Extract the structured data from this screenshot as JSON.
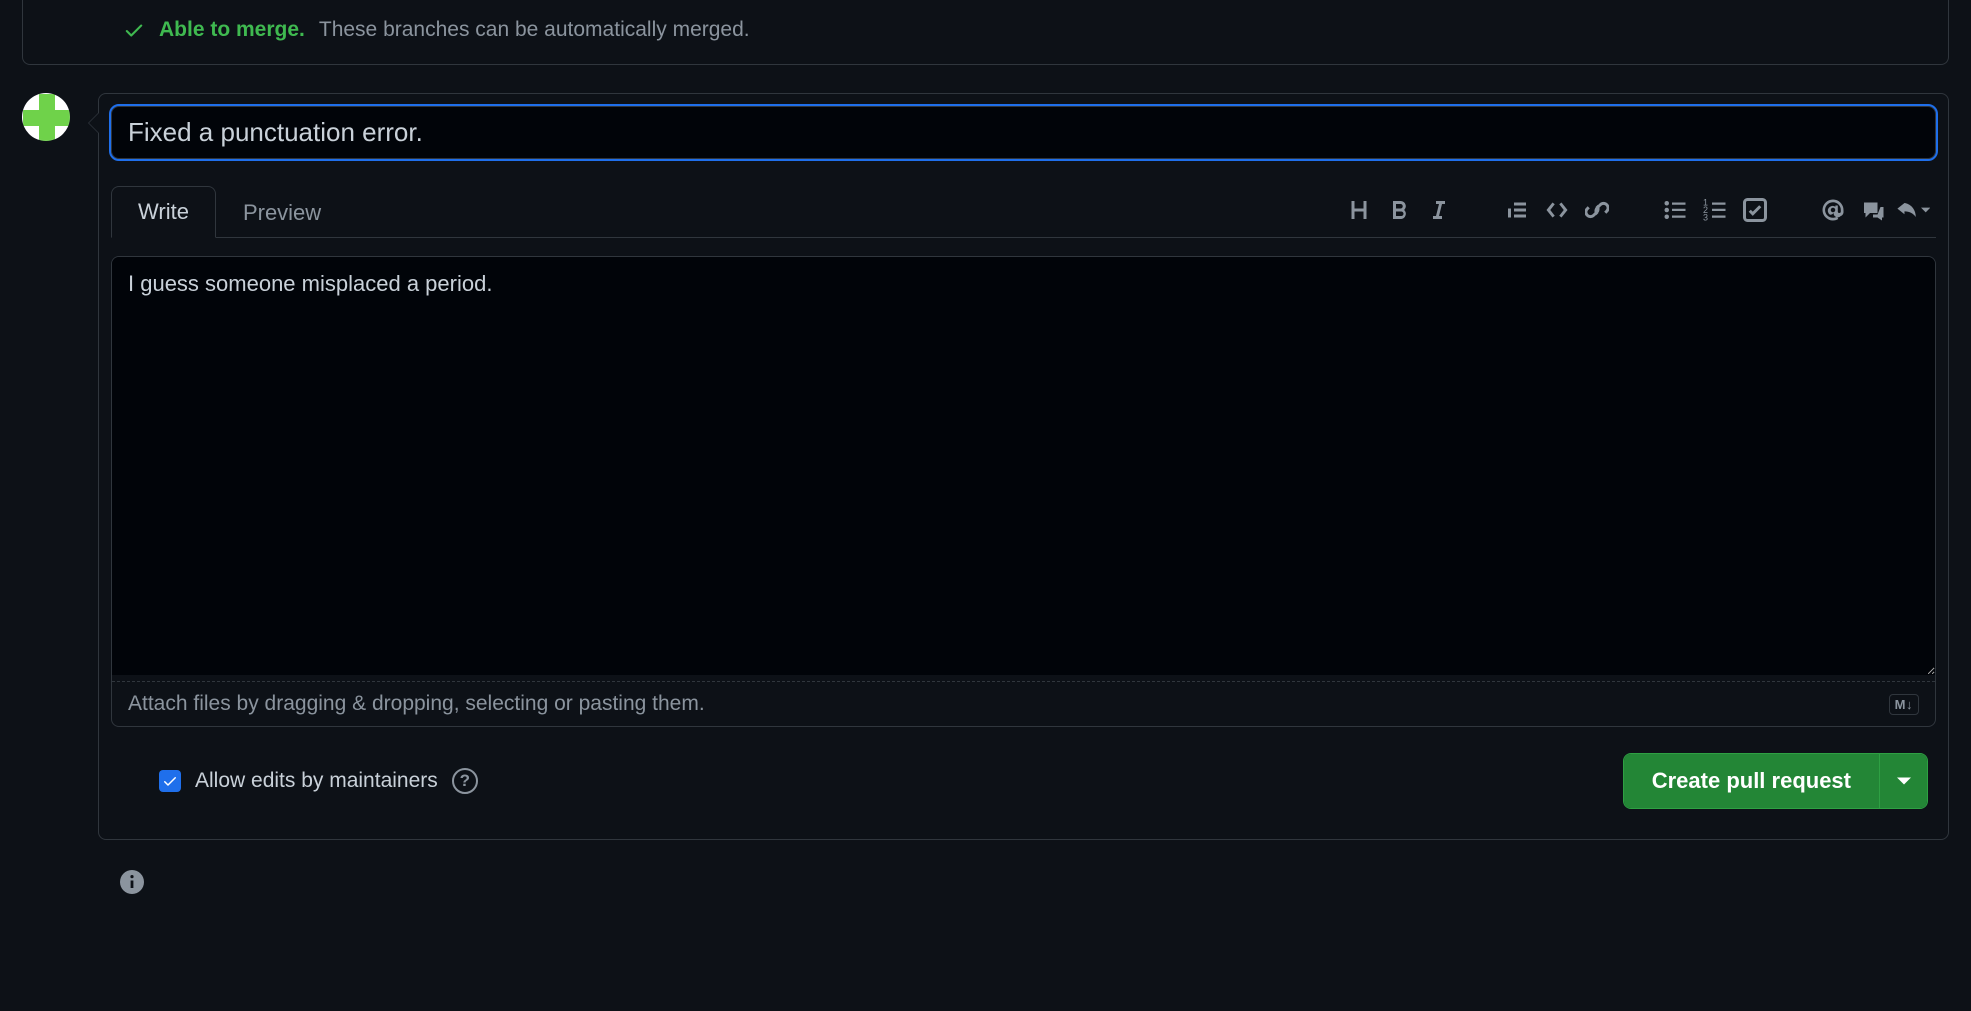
{
  "merge": {
    "title": "Able to merge.",
    "desc": "These branches can be automatically merged."
  },
  "title_value": "Fixed a punctuation error.",
  "tabs": {
    "write": "Write",
    "preview": "Preview"
  },
  "body_value": "I guess someone misplaced a period.",
  "attach_hint": "Attach files by dragging & dropping, selecting or pasting them.",
  "markdown_badge": "M↓",
  "allow_edits_label": "Allow edits by maintainers",
  "create_label": "Create pull request"
}
